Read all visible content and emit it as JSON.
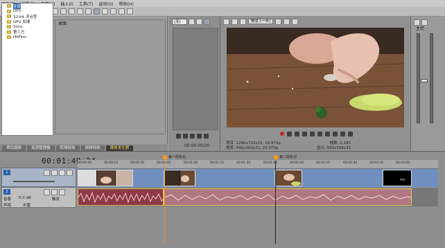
{
  "menu": [
    "文件(F)",
    "编辑(E)",
    "查看(V)",
    "插入(I)",
    "工具(T)",
    "选项(O)",
    "帮助(H)"
  ],
  "explorer": {
    "path_label": "桌面:",
    "tree_items": [
      "全部",
      "DFX",
      "32-bit 浮点型",
      "GPU 加速",
      "Sony",
      "第三方",
      "HitFilm"
    ],
    "selected": "全部",
    "tabs": [
      "项目媒体",
      "资源管理器",
      "转场特效",
      "视频特效",
      "媒体发生器"
    ],
    "active_tab": "媒体发生器"
  },
  "trimmer": {
    "dropdown": "(无)",
    "timecode": "00:00:00,00"
  },
  "preview": {
    "quality": "预览 (一半)",
    "info_left": "项目: 1280x720x32, 29.970p",
    "info_left2": "预览: 640x360x32, 29.970p",
    "info_right": "帧数: 1,295",
    "info_right2": "显示: 593x334x32"
  },
  "mixer": {
    "label": "主控"
  },
  "timeline": {
    "timecode": "00:01:49.24",
    "ruler_ticks": [
      "00:00:00",
      "00:00:15",
      "00:00:30",
      "00:00:45",
      "00:01:00",
      "00:01:15",
      "00:01:30",
      "00:01:45",
      "00:02:00",
      "00:02:15",
      "00:02:30",
      "00:02:45",
      "00:03:00"
    ],
    "markers": [
      {
        "label": "第一段标记"
      },
      {
        "label": "第二段标记"
      }
    ],
    "video_track": {
      "number": "1",
      "level": "级别: 100.0 %"
    },
    "audio_track": {
      "number": "2",
      "vol_label": "音量",
      "vol_value": "0.0 dB",
      "pan_label": "声相",
      "pan_value": "中置",
      "mode": "触发"
    }
  },
  "colors": {
    "accent": "#f29a27",
    "active_tab_text": "#ffde65",
    "video_track": "#6f8fbf",
    "audio_clip": "#8e3a45"
  }
}
